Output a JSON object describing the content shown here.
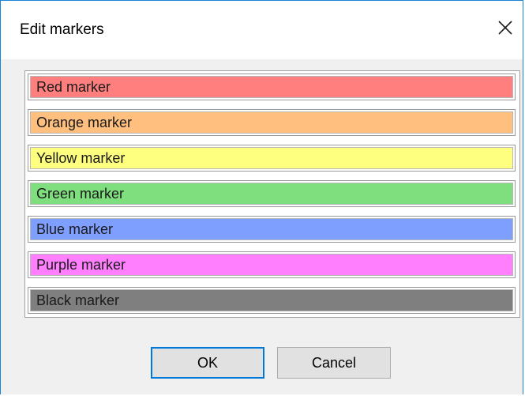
{
  "dialog": {
    "title": "Edit markers",
    "close_icon": "close-icon"
  },
  "markers": [
    {
      "label": "Red marker",
      "color": "#ff7f7f"
    },
    {
      "label": "Orange marker",
      "color": "#ffbf7f"
    },
    {
      "label": "Yellow marker",
      "color": "#ffff7f"
    },
    {
      "label": "Green marker",
      "color": "#7fdf7f"
    },
    {
      "label": "Blue marker",
      "color": "#7f9fff"
    },
    {
      "label": "Purple marker",
      "color": "#ff7fff"
    },
    {
      "label": "Black marker",
      "color": "#7f7f7f"
    }
  ],
  "buttons": {
    "ok_label": "OK",
    "cancel_label": "Cancel"
  },
  "colors": {
    "accent": "#0078d7",
    "window_border": "#1883d7"
  }
}
